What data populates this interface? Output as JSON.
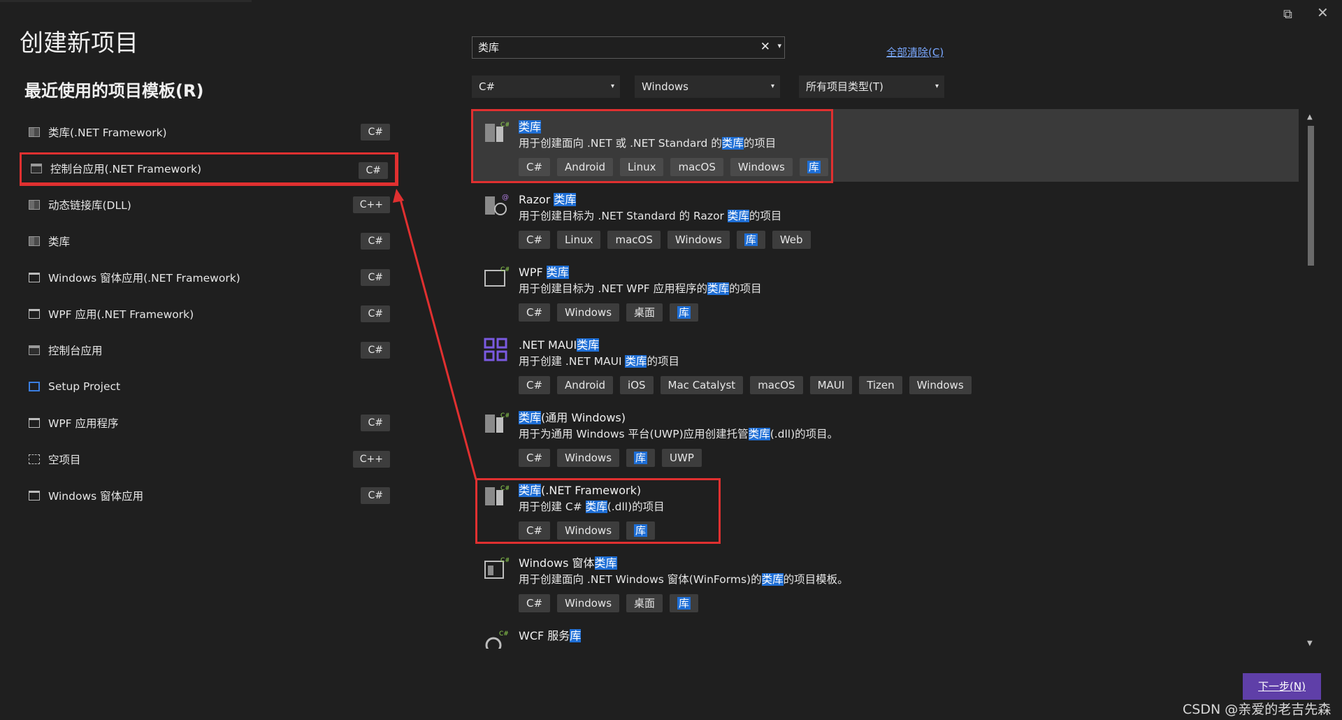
{
  "window": {
    "restore_glyph": "⧉",
    "close_glyph": "✕"
  },
  "page_title": "创建新项目",
  "recent": {
    "title": "最近使用的项目模板(R)",
    "items": [
      {
        "label": "类库(.NET Framework)",
        "lang": "C#",
        "icon": "class-library-icon"
      },
      {
        "label": "控制台应用(.NET Framework)",
        "lang": "C#",
        "icon": "console-app-icon"
      },
      {
        "label": "动态链接库(DLL)",
        "lang": "C++",
        "icon": "dll-icon"
      },
      {
        "label": "类库",
        "lang": "C#",
        "icon": "class-library-icon"
      },
      {
        "label": "Windows 窗体应用(.NET Framework)",
        "lang": "C#",
        "icon": "windows-forms-icon"
      },
      {
        "label": "WPF 应用(.NET Framework)",
        "lang": "C#",
        "icon": "wpf-icon"
      },
      {
        "label": "控制台应用",
        "lang": "C#",
        "icon": "console-app-icon"
      },
      {
        "label": "Setup Project",
        "lang": "",
        "icon": "setup-project-icon"
      },
      {
        "label": "WPF 应用程序",
        "lang": "C#",
        "icon": "wpf-icon"
      },
      {
        "label": "空项目",
        "lang": "C++",
        "icon": "empty-project-icon"
      },
      {
        "label": "Windows 窗体应用",
        "lang": "C#",
        "icon": "windows-forms-icon"
      }
    ]
  },
  "search": {
    "value": "类库",
    "clear_glyph": "✕",
    "dropdown_glyph": "▾"
  },
  "clear_all": "全部清除(C)",
  "filters": {
    "language": "C#",
    "platform": "Windows",
    "project_type": "所有项目类型(T)",
    "arrow": "▾"
  },
  "results": [
    {
      "name_pre": "",
      "name_hl": "类库",
      "name_post": "",
      "desc_pre": "用于创建面向 .NET 或 .NET Standard 的",
      "desc_hl": "类库",
      "desc_post": "的项目",
      "tags": [
        "C#",
        "Android",
        "Linux",
        "macOS",
        "Windows"
      ],
      "lib_tag": "库",
      "extra_tags": []
    },
    {
      "name_pre": "Razor ",
      "name_hl": "类库",
      "name_post": "",
      "desc_pre": "用于创建目标为 .NET Standard 的 Razor ",
      "desc_hl": "类库",
      "desc_post": "的项目",
      "tags": [
        "C#",
        "Linux",
        "macOS",
        "Windows"
      ],
      "lib_tag": "库",
      "extra_tags": [
        "Web"
      ]
    },
    {
      "name_pre": "WPF ",
      "name_hl": "类库",
      "name_post": "",
      "desc_pre": "用于创建目标为 .NET WPF 应用程序的",
      "desc_hl": "类库",
      "desc_post": "的项目",
      "tags": [
        "C#",
        "Windows",
        "桌面"
      ],
      "lib_tag": "库",
      "extra_tags": []
    },
    {
      "name_pre": ".NET MAUI",
      "name_hl": "类库",
      "name_post": "",
      "desc_pre": "用于创建 .NET MAUI ",
      "desc_hl": "类库",
      "desc_post": "的项目",
      "tags": [
        "C#",
        "Android",
        "iOS",
        "Mac Catalyst",
        "macOS",
        "MAUI",
        "Tizen",
        "Windows"
      ],
      "lib_tag": "",
      "extra_tags": []
    },
    {
      "name_pre": "",
      "name_hl": "类库",
      "name_post": "(通用 Windows)",
      "desc_pre": "用于为通用 Windows 平台(UWP)应用创建托管",
      "desc_hl": "类库",
      "desc_post": "(.dll)的项目。",
      "tags": [
        "C#",
        "Windows"
      ],
      "lib_tag": "库",
      "extra_tags": [
        "UWP"
      ]
    },
    {
      "name_pre": "",
      "name_hl": "类库",
      "name_post": "(.NET Framework)",
      "desc_pre": "用于创建 C# ",
      "desc_hl": "类库",
      "desc_post": "(.dll)的项目",
      "tags": [
        "C#",
        "Windows"
      ],
      "lib_tag": "库",
      "extra_tags": []
    },
    {
      "name_pre": "Windows 窗体",
      "name_hl": "类库",
      "name_post": "",
      "desc_pre": "用于创建面向 .NET Windows 窗体(WinForms)的",
      "desc_hl": "类库",
      "desc_post": "的项目模板。",
      "tags": [
        "C#",
        "Windows",
        "桌面"
      ],
      "lib_tag": "库",
      "extra_tags": []
    },
    {
      "name_pre": "WCF 服务",
      "name_hl": "库",
      "name_post": "",
      "desc_pre": "",
      "desc_hl": "",
      "desc_post": "",
      "tags": [],
      "lib_tag": "",
      "extra_tags": []
    }
  ],
  "next_button": "下一步(N)",
  "watermark": "CSDN @亲爱的老吉先森",
  "colors": {
    "highlight": "#1f6fd6",
    "annotation_red": "#e03030",
    "primary_button": "#5f3fa8"
  }
}
